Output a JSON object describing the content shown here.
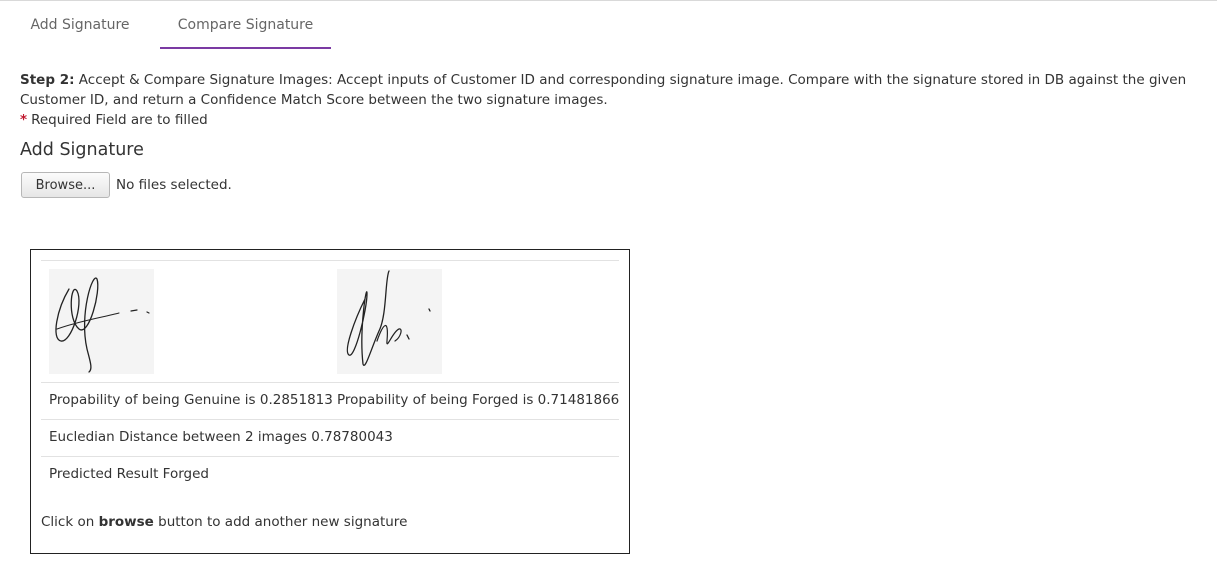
{
  "tabs": [
    {
      "label": "Add Signature",
      "active": false
    },
    {
      "label": "Compare Signature",
      "active": true
    }
  ],
  "accent_color": "#7b3aa3",
  "step": {
    "label": "Step 2:",
    "text": "Accept & Compare Signature Images: Accept inputs of Customer ID and corresponding signature image. Compare with the signature stored in DB against the given Customer ID, and return a Confidence Match Score between the two signature images."
  },
  "required_note": {
    "star": "*",
    "text": "Required Field are to filled"
  },
  "add_signature": {
    "title": "Add Signature",
    "browse_label": "Browse...",
    "file_status": "No files selected."
  },
  "result": {
    "images": [
      {
        "icon": "signature-image-reference"
      },
      {
        "icon": "signature-image-uploaded"
      }
    ],
    "genuine_text": "Propability of being Genuine is 0.2851813",
    "forged_text": "Propability of being Forged is 0.71481866",
    "distance_text": "Eucledian Distance between 2 images 0.78780043",
    "prediction_text": "Predicted Result Forged",
    "footer": {
      "pre": "Click on ",
      "bold": "browse",
      "post": " button to add another new signature"
    }
  }
}
